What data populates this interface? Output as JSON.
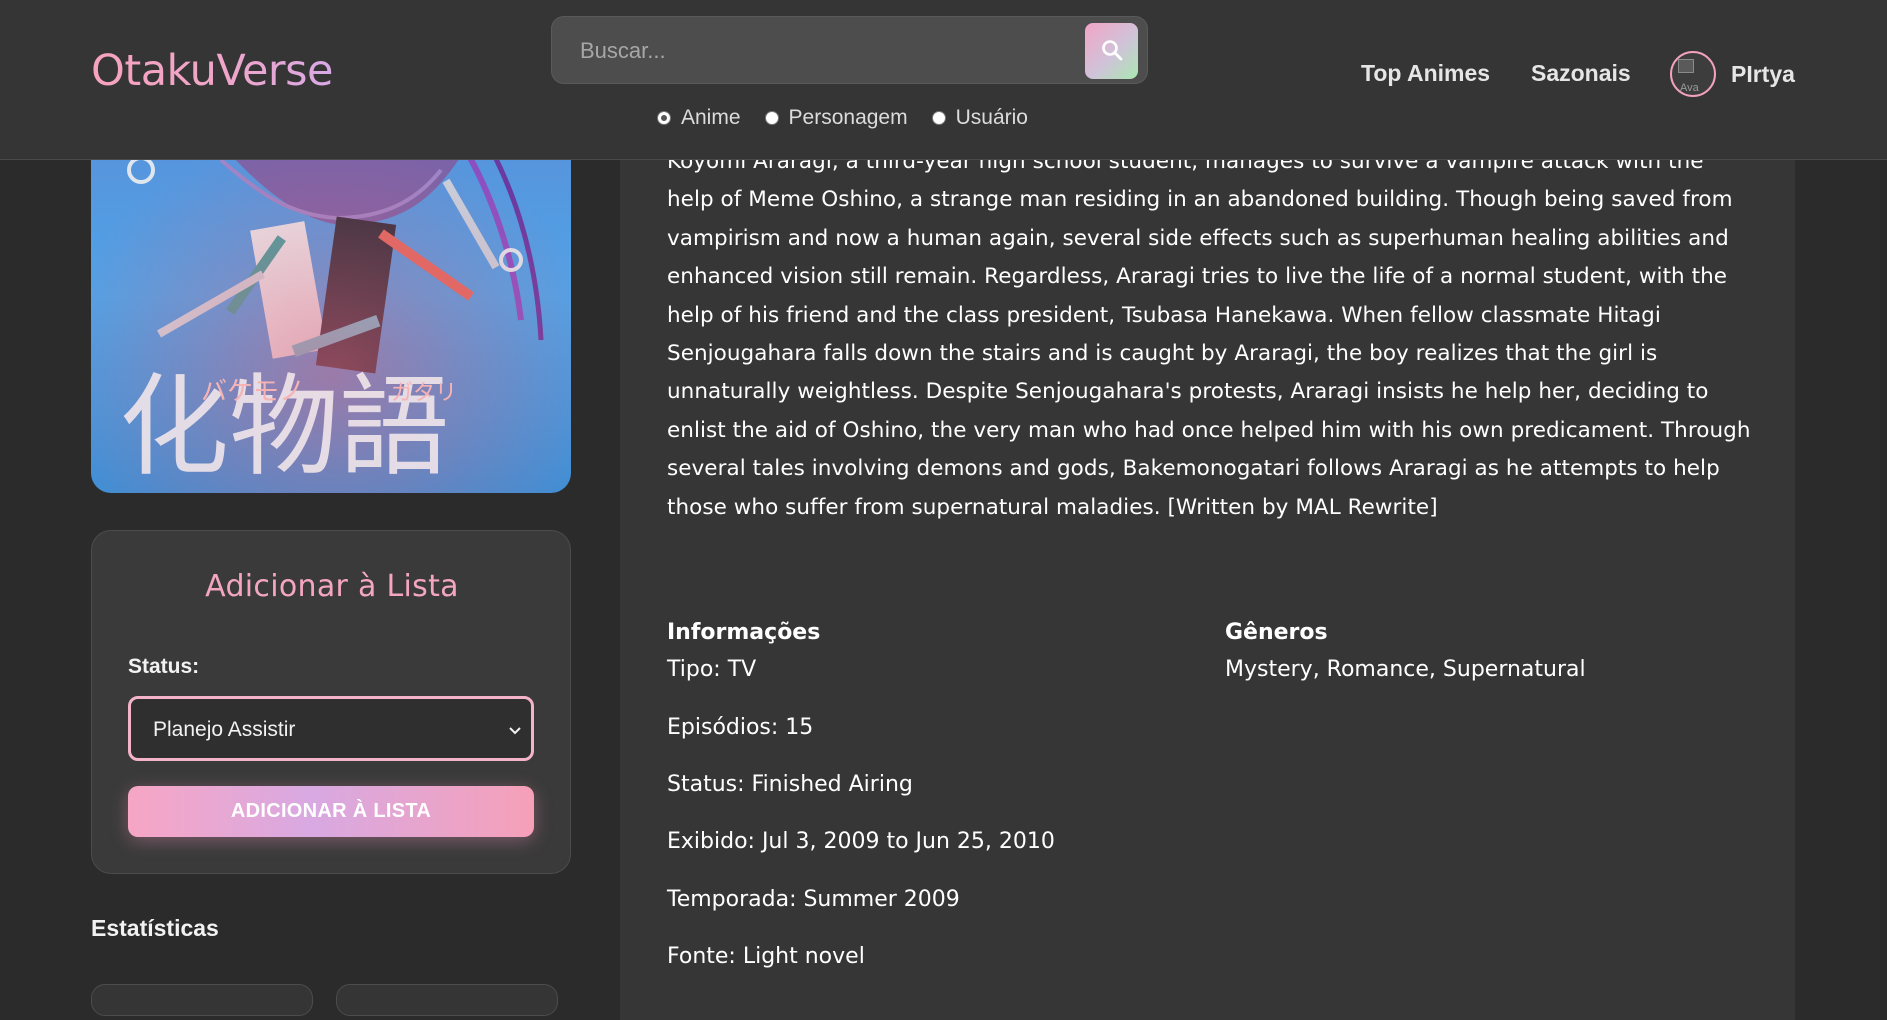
{
  "header": {
    "logo": "OtakuVerse",
    "search": {
      "placeholder": "Buscar...",
      "value": ""
    },
    "search_type": {
      "options": [
        "Anime",
        "Personagem",
        "Usuário"
      ],
      "selected": "Anime"
    },
    "nav": {
      "top_animes": "Top Animes",
      "seasonal": "Sazonais"
    },
    "user": {
      "name": "PIrtya",
      "avatar_alt": "Ava"
    }
  },
  "poster": {
    "title_art": "化物語",
    "kana_left": "バケモノ",
    "kana_right": "ガタリ"
  },
  "add_to_list": {
    "title": "Adicionar à Lista",
    "status_label": "Status:",
    "status_selected": "Planejo Assistir",
    "button_label": "ADICIONAR À LISTA"
  },
  "stats": {
    "title": "Estatísticas"
  },
  "synopsis": "Koyomi Araragi, a third-year high school student, manages to survive a vampire attack with the help of Meme Oshino, a strange man residing in an abandoned building. Though being saved from vampirism and now a human again, several side effects such as superhuman healing abilities and enhanced vision still remain. Regardless, Araragi tries to live the life of a normal student, with the help of his friend and the class president, Tsubasa Hanekawa. When fellow classmate Hitagi Senjougahara falls down the stairs and is caught by Araragi, the boy realizes that the girl is unnaturally weightless. Despite Senjougahara's protests, Araragi insists he help her, deciding to enlist the aid of Oshino, the very man who had once helped him with his own predicament. Through several tales involving demons and gods, Bakemonogatari follows Araragi as he attempts to help those who suffer from supernatural maladies. [Written by MAL Rewrite]",
  "info": {
    "heading": "Informações",
    "type": "Tipo: TV",
    "episodes": "Episódios: 15",
    "status": "Status: Finished Airing",
    "aired": "Exibido: Jul 3, 2009 to Jun 25, 2010",
    "season": "Temporada: Summer 2009",
    "source": "Fonte: Light novel"
  },
  "genres": {
    "heading": "Gêneros",
    "list": "Mystery, Romance, Supernatural"
  },
  "colors": {
    "accent_pink": "#f4a6c0",
    "background": "#2b2b2b",
    "panel": "#363636",
    "header": "#353535"
  },
  "icons": {
    "search": "search-icon",
    "select_chevron": "chevron-down-icon"
  }
}
